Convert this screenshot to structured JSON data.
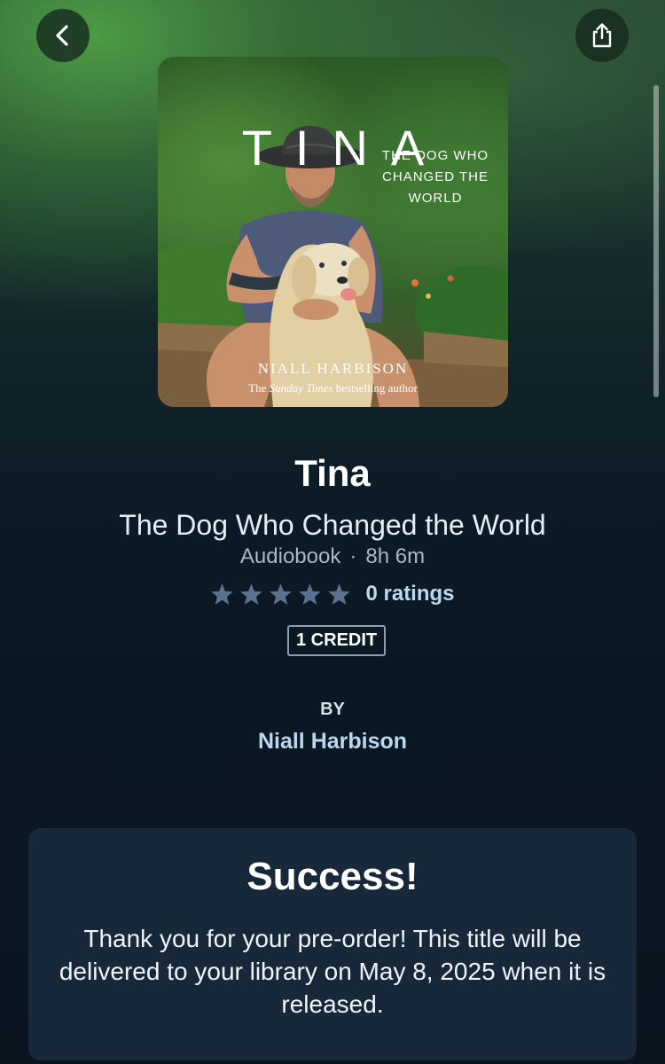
{
  "header": {
    "back_icon": "chevron-left-icon",
    "share_icon": "share-icon"
  },
  "cover": {
    "title": "TINA",
    "subtitle": "THE DOG WHO CHANGED THE WORLD",
    "author": "NIALL HARBISON",
    "tagline_prefix": "The ",
    "tagline_italic": "Sunday Times",
    "tagline_suffix": " bestselling author"
  },
  "book": {
    "title": "Tina",
    "subtitle": "The Dog Who Changed the World",
    "format": "Audiobook",
    "separator": "·",
    "length": "8h 6m",
    "stars_filled": 0,
    "stars_total": 5,
    "ratings_label": "0 ratings",
    "credit_badge": "1 CREDIT",
    "by_label": "BY",
    "author": "Niall Harbison"
  },
  "success": {
    "title": "Success!",
    "message": "Thank you for your pre-order! This title will be delivered to your library on May 8, 2025 when it is released."
  },
  "colors": {
    "link": "#bcd7ee",
    "star": "#5b718e",
    "panel": "#16283a"
  }
}
